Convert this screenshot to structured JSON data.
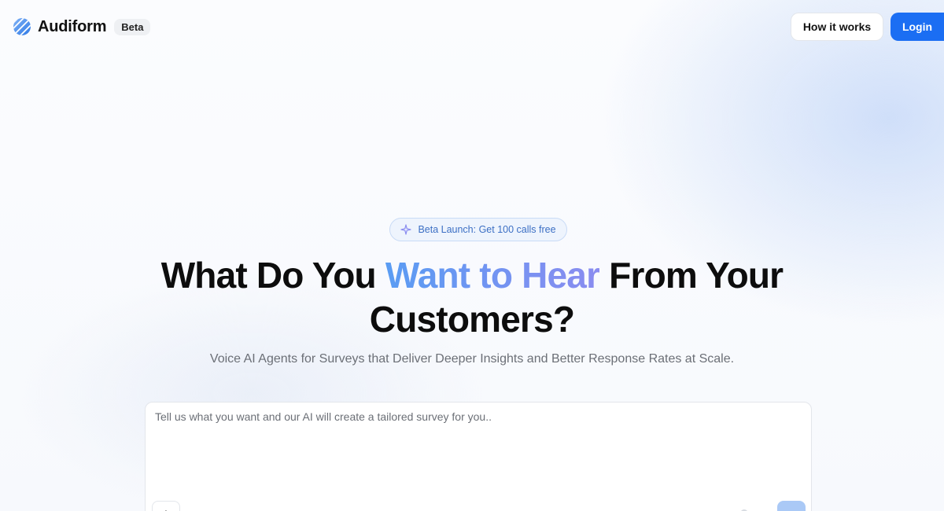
{
  "header": {
    "brand": "Audiform",
    "badge": "Beta",
    "nav_how": "How it works",
    "nav_login": "Login"
  },
  "hero": {
    "launch_pill": "Beta Launch: Get 100 calls free",
    "headline_part1": "What Do You ",
    "headline_highlight": "Want to Hear",
    "headline_part2": " From Your",
    "headline_line2": "Customers?",
    "subtitle": "Voice AI Agents for Surveys that Deliver Deeper Insights and Better Response Rates at Scale."
  },
  "prompt": {
    "placeholder": "Tell us what you want and our AI will create a tailored survey for you..",
    "value": "",
    "attach_label": "+"
  },
  "icons": {
    "logo": "audiform-logo-icon",
    "sparkle": "sparkle-icon",
    "mic": "mic-icon",
    "send": "send-icon"
  },
  "colors": {
    "accent": "#1b6ef3",
    "gradient_start": "#5a9cf3",
    "gradient_end": "#8a8cf0",
    "pill_text": "#3c6fc4"
  }
}
